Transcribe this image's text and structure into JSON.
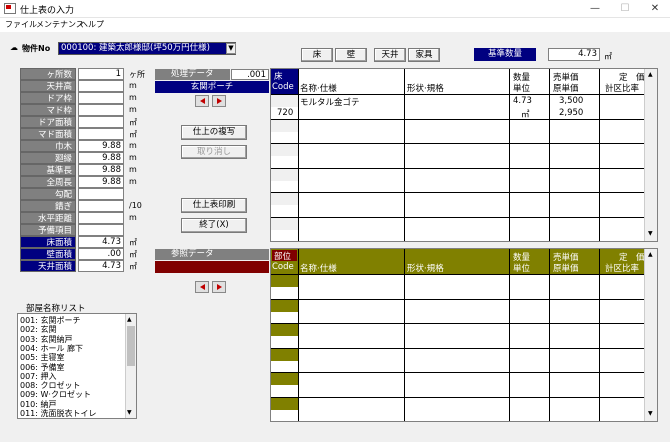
{
  "window": {
    "title": "仕上表の入力",
    "min": "—",
    "max": "☐",
    "close": "✕"
  },
  "menu": [
    "ファイル",
    "メンテナンス",
    "ヘルプ"
  ],
  "top": {
    "bukken_label": "物件No",
    "bukken_value": "000100: 建築太郎様邸(坪50万円仕様)",
    "btn_floor": "床",
    "btn_wall": "壁",
    "btn_ceiling": "天井",
    "btn_furniture": "家具",
    "base_qty_label": "基準数量",
    "base_qty_value": "4.73",
    "base_qty_unit": "㎡"
  },
  "params": [
    {
      "label": "ヶ所数",
      "value": "1",
      "unit": "ヶ所",
      "blue": false
    },
    {
      "label": "天井高",
      "value": "",
      "unit": "m",
      "blue": false
    },
    {
      "label": "ドア枠",
      "value": "",
      "unit": "m",
      "blue": false
    },
    {
      "label": "マド枠",
      "value": "",
      "unit": "m",
      "blue": false
    },
    {
      "label": "ドア面積",
      "value": "",
      "unit": "㎡",
      "blue": false
    },
    {
      "label": "マド面積",
      "value": "",
      "unit": "㎡",
      "blue": false
    },
    {
      "label": "巾木",
      "value": "9.88",
      "unit": "m",
      "blue": false
    },
    {
      "label": "廻縁",
      "value": "9.88",
      "unit": "m",
      "blue": false
    },
    {
      "label": "基準長",
      "value": "9.88",
      "unit": "m",
      "blue": false
    },
    {
      "label": "全周長",
      "value": "9.88",
      "unit": "m",
      "blue": false
    },
    {
      "label": "勾配",
      "value": "",
      "unit": "",
      "blue": false
    },
    {
      "label": "錆ぎ",
      "value": "",
      "unit": "/10",
      "blue": false
    },
    {
      "label": "水平距離",
      "value": "",
      "unit": "m",
      "blue": false
    },
    {
      "label": "予備項目",
      "value": "",
      "unit": "",
      "blue": false
    },
    {
      "label": "床面積",
      "value": "4.73",
      "unit": "㎡",
      "blue": true
    },
    {
      "label": "壁面積",
      "value": ".00",
      "unit": "㎡",
      "blue": true
    },
    {
      "label": "天井面積",
      "value": "4.73",
      "unit": "㎡",
      "blue": true
    }
  ],
  "proc": {
    "label": "処理データ",
    "value": ".001",
    "room": "玄関ポーチ",
    "btn_copy": "仕上の複写",
    "btn_cancel": "取り消し",
    "btn_print": "仕上表印刷",
    "btn_end": "終了(X)"
  },
  "ref": {
    "label": "参照データ"
  },
  "room_list_label": "部屋名称リスト",
  "rooms": [
    "001: 玄関ポーチ",
    "002: 玄関",
    "003: 玄関納戸",
    "004: ホール 廊下",
    "005: 主寝室",
    "006: 予備室",
    "007: 押入",
    "008: クロゼット",
    "009: W·クロゼット",
    "010: 納戸",
    "011: 洗面脱衣トイレ"
  ],
  "table1": {
    "tag": "床",
    "code": "Code",
    "name": "名称·仕様",
    "shape": "形状·規格",
    "qty": "数量",
    "unit": "単位",
    "sell": "売単価",
    "cost": "原単価",
    "fixed": "定　価",
    "ratio": "計区比率",
    "row": {
      "name": "モルタル金ゴテ",
      "code": "720",
      "qty": "4.73",
      "unit": "㎡",
      "sell": "3,500",
      "cost": "2,950"
    }
  },
  "table2": {
    "tag": "部位",
    "code": "Code",
    "name": "名称·仕様",
    "shape": "形状·規格",
    "qty": "数量",
    "unit": "単位",
    "sell": "売単価",
    "cost": "原単価",
    "fixed": "定　価",
    "ratio": "計区比率"
  },
  "colors": {
    "navy": "#000080",
    "olive": "#808000",
    "maroon": "#800000",
    "red": "#ff0000"
  }
}
